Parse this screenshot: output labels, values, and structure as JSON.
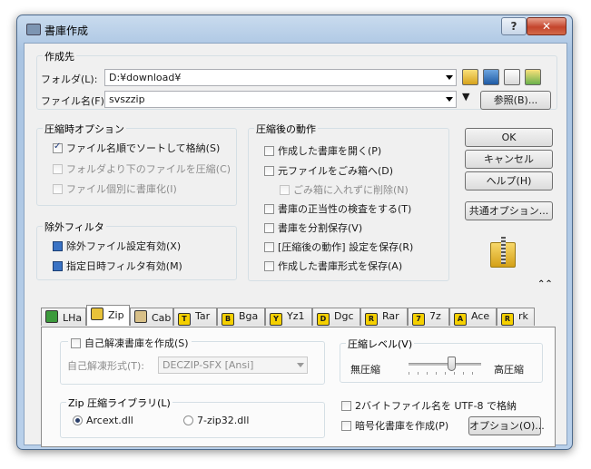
{
  "window": {
    "title": "書庫作成",
    "help_label": "?",
    "close_label": "✕"
  },
  "dest": {
    "group_label": "作成先",
    "folder_label": "フォルダ(L):",
    "folder_value": "D:¥download¥",
    "file_label": "ファイル名(F):",
    "file_value": "svszzip",
    "browse_label": "参照(B)..."
  },
  "compress_options": {
    "group_label": "圧縮時オプション",
    "items": [
      {
        "label": "ファイル名順でソートして格納(S)",
        "checked": true,
        "enabled": true
      },
      {
        "label": "フォルダより下のファイルを圧縮(C)",
        "checked": false,
        "enabled": false
      },
      {
        "label": "ファイル個別に書庫化(I)",
        "checked": false,
        "enabled": false
      }
    ]
  },
  "exclude_filter": {
    "group_label": "除外フィルタ",
    "items": [
      {
        "label": "除外ファイル設定有効(X)",
        "checked": true
      },
      {
        "label": "指定日時フィルタ有効(M)",
        "checked": true
      }
    ]
  },
  "after_actions": {
    "group_label": "圧縮後の動作",
    "items": [
      {
        "label": "作成した書庫を開く(P)"
      },
      {
        "label": "元ファイルをごみ箱へ(D)"
      },
      {
        "label": "ごみ箱に入れずに削除(N)"
      },
      {
        "label": "書庫の正当性の検査をする(T)"
      },
      {
        "label": "書庫を分割保存(V)"
      },
      {
        "label": "[圧縮後の動作] 設定を保存(R)"
      },
      {
        "label": "作成した書庫形式を保存(A)"
      }
    ]
  },
  "buttons": {
    "ok": "OK",
    "cancel": "キャンセル",
    "help": "ヘルプ(H)",
    "common_options": "共通オプション...",
    "collapse": "⌃⌃"
  },
  "tabs": [
    {
      "label": "LHa",
      "icon": "lha-icon",
      "color": "#3c9a3c"
    },
    {
      "label": "Zip",
      "icon": "zip-icon",
      "color": "#e8c23a",
      "active": true
    },
    {
      "label": "Cab",
      "icon": "cab-icon",
      "color": "#d8c088"
    },
    {
      "label": "Tar",
      "icon": "tar-icon",
      "color": "#f5d000",
      "glyph": "T"
    },
    {
      "label": "Bga",
      "icon": "bga-icon",
      "color": "#f5d000",
      "glyph": "B"
    },
    {
      "label": "Yz1",
      "icon": "yz1-icon",
      "color": "#f5d000",
      "glyph": "Y"
    },
    {
      "label": "Dgc",
      "icon": "dgc-icon",
      "color": "#f5d000",
      "glyph": "D"
    },
    {
      "label": "Rar",
      "icon": "rar-icon",
      "color": "#f5d000",
      "glyph": "R"
    },
    {
      "label": "7z",
      "icon": "7z-icon",
      "color": "#f5d000",
      "glyph": "7"
    },
    {
      "label": "Ace",
      "icon": "ace-icon",
      "color": "#f5d000",
      "glyph": "A"
    },
    {
      "label": "rk",
      "icon": "rk-icon",
      "color": "#f5d000",
      "glyph": "R"
    }
  ],
  "zip_tab": {
    "sfx_label": "自己解凍書庫を作成(S)",
    "sfx_format_label": "自己解凍形式(T):",
    "sfx_format_value": "DECZIP-SFX [Ansi]",
    "level_group_label": "圧縮レベル(V)",
    "level_low": "無圧縮",
    "level_high": "高圧縮",
    "level_value": 0.6,
    "library_group_label": "Zip 圧縮ライブラリ(L)",
    "library_options": [
      "Arcext.dll",
      "7-zip32.dll"
    ],
    "library_selected": "Arcext.dll",
    "utf8_label": "2バイトファイル名を UTF-8 で格納",
    "encrypt_label": "暗号化書庫を作成(P)",
    "options_button": "オプション(O)..."
  }
}
